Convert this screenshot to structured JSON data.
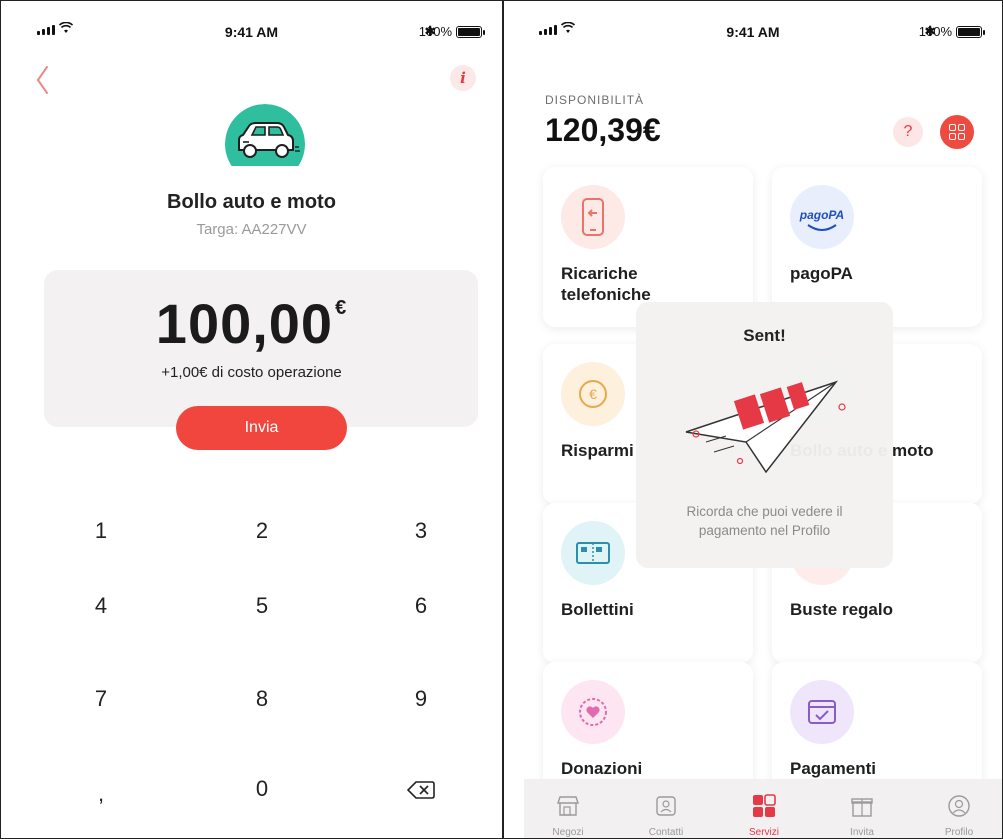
{
  "status_bar": {
    "time": "9:41 AM",
    "battery": "100%"
  },
  "left": {
    "title": "Bollo auto e moto",
    "plate": "Targa: AA227VV",
    "amount": "100,00",
    "currency": "€",
    "fee_note": "+1,00€ di costo operazione",
    "send_label": "Invia",
    "keypad": [
      "1",
      "2",
      "3",
      "4",
      "5",
      "6",
      "7",
      "8",
      "9",
      ",",
      "0"
    ],
    "icons": {
      "back": "chevron-left-icon",
      "info": "info-icon",
      "avatar": "car-icon",
      "delete": "backspace-icon"
    },
    "info_glyph": "i"
  },
  "right": {
    "availability_label": "DISPONIBILITÀ",
    "balance": "120,39€",
    "help_glyph": "?",
    "tiles": [
      {
        "label": "Ricariche telefoniche",
        "icon": "phone-topup-icon"
      },
      {
        "label": "pagoPA",
        "icon": "pagopa-logo-icon",
        "logo_text": "pagoPA"
      },
      {
        "label": "Risparmi",
        "icon": "euro-coin-icon"
      },
      {
        "label": "Bollo auto e moto",
        "icon": "car-icon"
      },
      {
        "label": "Bollettini",
        "icon": "bill-icon"
      },
      {
        "label": "Buste regalo",
        "icon": "gift-envelope-icon"
      },
      {
        "label": "Donazioni",
        "icon": "heart-icon"
      },
      {
        "label": "Pagamenti",
        "icon": "payment-check-icon"
      }
    ],
    "toast": {
      "title": "Sent!",
      "message": "Ricorda che puoi vedere il pagamento nel Profilo"
    },
    "tabbar": [
      {
        "label": "Negozi",
        "icon": "store-icon"
      },
      {
        "label": "Contatti",
        "icon": "contacts-icon"
      },
      {
        "label": "Servizi",
        "icon": "services-grid-icon",
        "active": true
      },
      {
        "label": "Invita",
        "icon": "gift-icon"
      },
      {
        "label": "Profilo",
        "icon": "profile-icon"
      }
    ]
  },
  "colors": {
    "accent": "#f0463e",
    "teal": "#2fbf9e",
    "card_bg": "#f3f1f1"
  }
}
